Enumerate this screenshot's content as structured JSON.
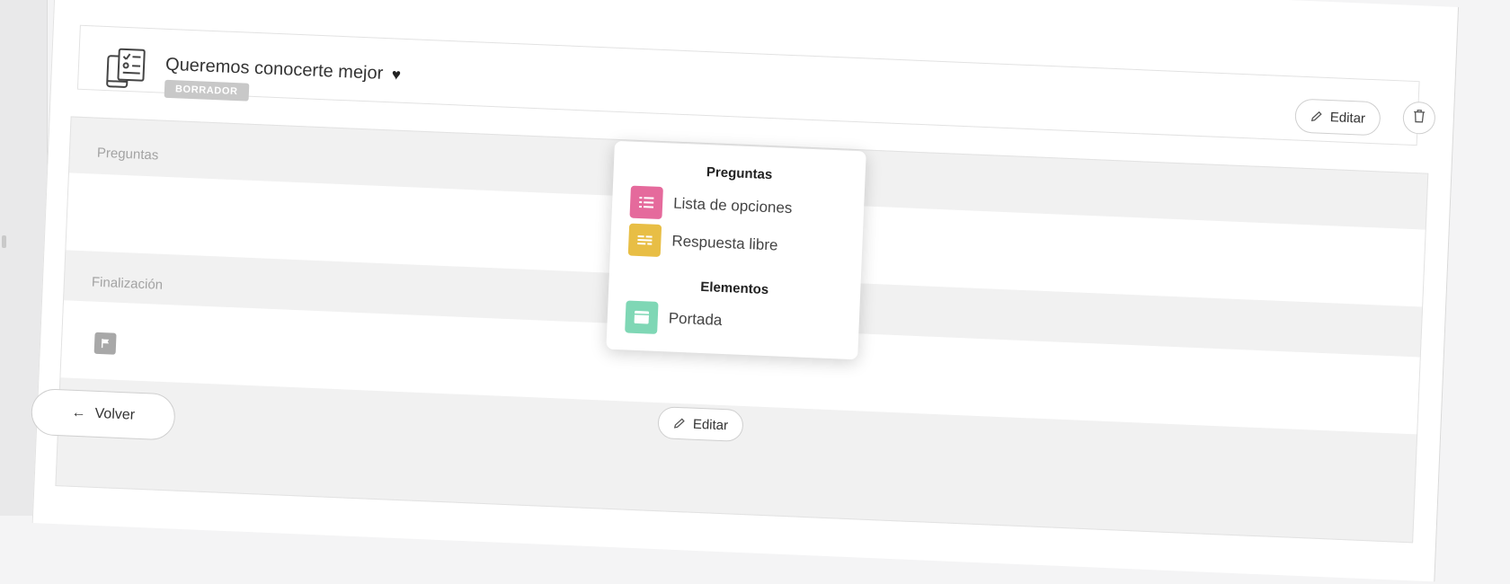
{
  "survey": {
    "title": "Queremos conocerte mejor",
    "heart": "♥",
    "status_badge": "BORRADOR",
    "edit_label": "Editar"
  },
  "sections": {
    "questions_title": "Preguntas",
    "ending_title": "Finalización",
    "edit_label": "Editar"
  },
  "back_button": {
    "arrow": "←",
    "label": "Volver"
  },
  "add_menu": {
    "questions_heading": "Preguntas",
    "elements_heading": "Elementos",
    "items": [
      {
        "label": "Lista de opciones",
        "icon": "list-options-icon",
        "color": "#e56a9c"
      },
      {
        "label": "Respuesta libre",
        "icon": "free-text-icon",
        "color": "#e8be45"
      },
      {
        "label": "Portada",
        "icon": "cover-icon",
        "color": "#7fd7b5"
      }
    ]
  }
}
